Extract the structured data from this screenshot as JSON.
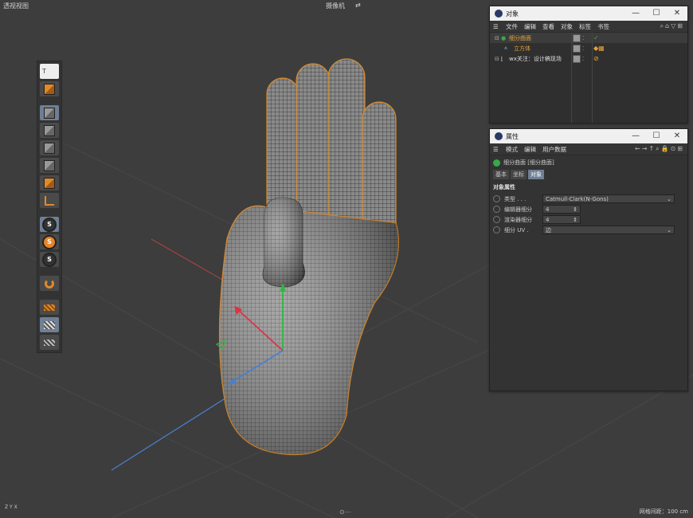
{
  "viewport": {
    "title": "透视视图",
    "camera": "摄像机",
    "camera_icon": "⇄",
    "grid_status": "网格间距：100 cm",
    "axis_label": "Z Y X",
    "bottom_icon": "⊙⋯"
  },
  "toolbar": {
    "top_label": "T"
  },
  "objects_panel": {
    "title": "对象",
    "menu": [
      "文件",
      "编辑",
      "查看",
      "对象",
      "标签",
      "书签"
    ],
    "rows": [
      {
        "name": "细分曲面",
        "color": "#e7a23a",
        "tag": "✓"
      },
      {
        "name": "立方体",
        "color": "#e7a23a",
        "tag": "◆▦"
      },
      {
        "name": "wx关注：设计稿现场",
        "color": "#dddddd",
        "tag": "⊘"
      }
    ]
  },
  "attributes_panel": {
    "title": "属性",
    "menu": [
      "模式",
      "编辑",
      "用户数据"
    ],
    "object_label": "细分曲面 [细分曲面]",
    "tabs": [
      "基本",
      "坐标",
      "对象"
    ],
    "section": "对象属性",
    "props": [
      {
        "label": "类型 . . .",
        "value": "Catmull-Clark(N-Gons)"
      },
      {
        "label": "编辑器细分",
        "value": "4"
      },
      {
        "label": "渲染器细分",
        "value": "4"
      },
      {
        "label": "细分 UV .",
        "value": "边"
      }
    ]
  },
  "colors": {
    "accent": "#e7a23a",
    "selection": "#6f7f95",
    "viewport_bg": "#3d3d3d"
  }
}
